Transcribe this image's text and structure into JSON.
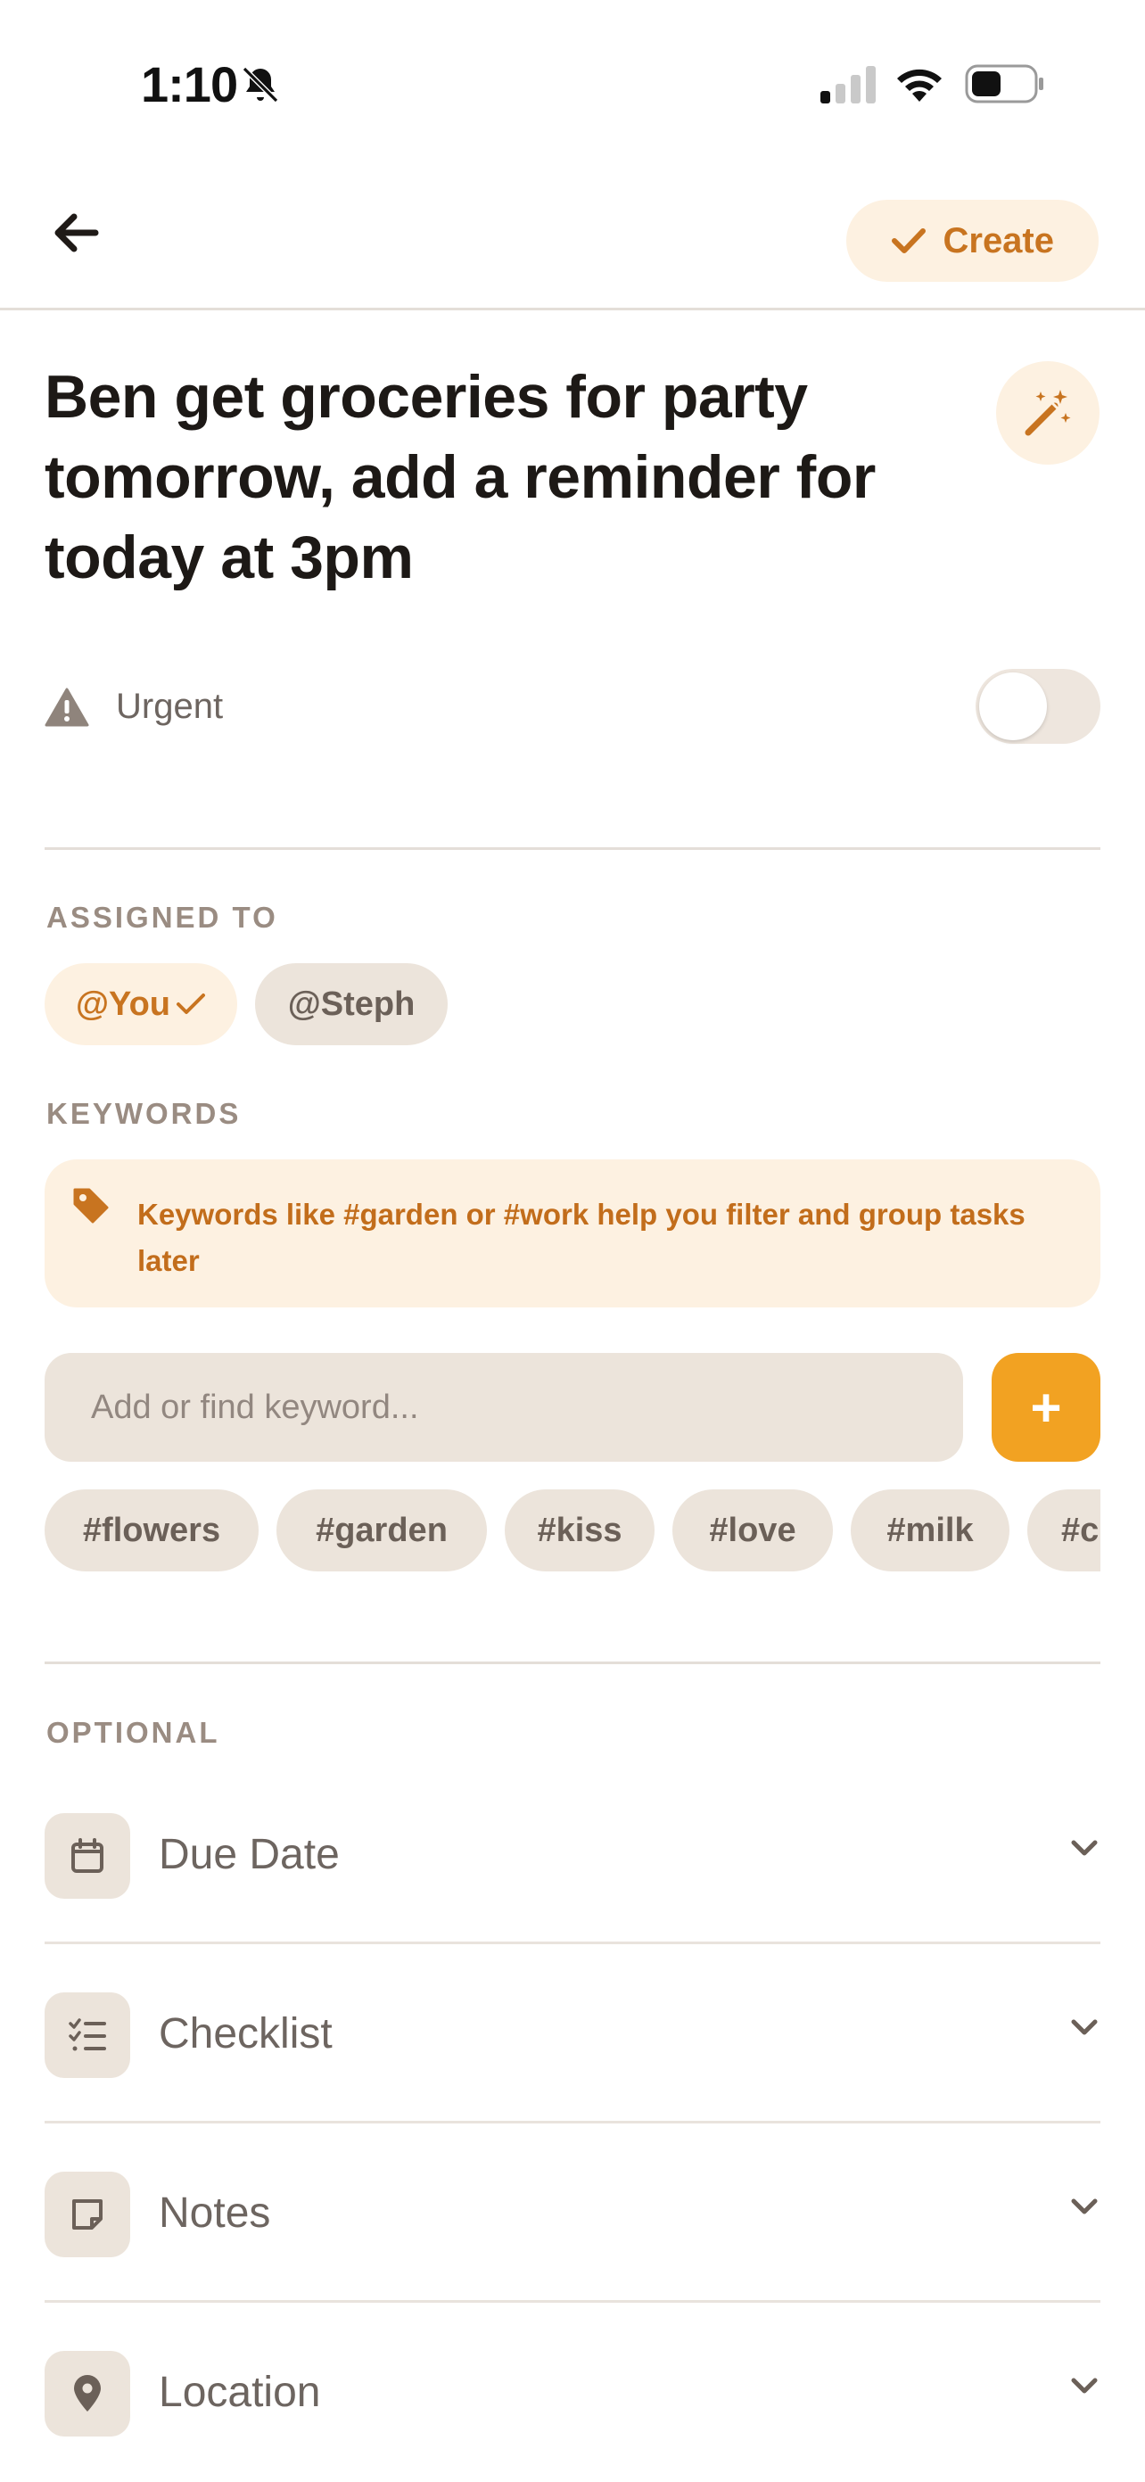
{
  "status_bar": {
    "time": "1:10",
    "icons": [
      "bell-slash-icon",
      "signal-icon",
      "wifi-icon",
      "battery-icon"
    ]
  },
  "header": {
    "back_icon": "arrow-left-icon",
    "create_label": "Create",
    "create_icon": "check-icon"
  },
  "task": {
    "title": "Ben get groceries for party tomorrow, add a reminder for today at 3pm",
    "magic_icon": "magic-wand-icon"
  },
  "urgent": {
    "label": "Urgent",
    "enabled": false
  },
  "assigned": {
    "section_label": "ASSIGNED TO",
    "people": [
      {
        "label": "@You",
        "selected": true
      },
      {
        "label": "@Steph",
        "selected": false
      }
    ]
  },
  "keywords": {
    "section_label": "KEYWORDS",
    "hint": "Keywords like #garden or #work help you filter and group tasks later",
    "input_placeholder": "Add or find keyword...",
    "add_label": "+",
    "chips": [
      "#flowers",
      "#garden",
      "#kiss",
      "#love",
      "#milk",
      "#c"
    ]
  },
  "optional": {
    "section_label": "OPTIONAL",
    "items": [
      {
        "label": "Due Date",
        "icon": "calendar-icon"
      },
      {
        "label": "Checklist",
        "icon": "checklist-icon"
      },
      {
        "label": "Notes",
        "icon": "note-icon"
      },
      {
        "label": "Location",
        "icon": "location-pin-icon"
      }
    ]
  },
  "colors": {
    "accent": "#c87420",
    "accent_bg": "#fdf1e1",
    "add_button": "#f2a222",
    "chip_bg": "#ece4db",
    "muted_text": "#6d6560"
  }
}
